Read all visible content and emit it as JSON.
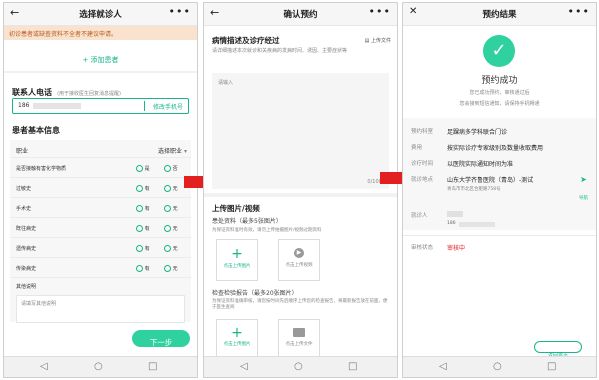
{
  "screen1": {
    "title": "选择就诊人",
    "back_icon": "back-arrow-icon",
    "more_icon": "more-icon",
    "warning": "初诊患者或缺查资料不全者不建议申请。",
    "add_patient": "+ 添加患者",
    "contact_heading": "联系人电话",
    "contact_note": "(用于接收医生回复消息提醒)",
    "phone_value": "186",
    "change_phone": "修改手机号",
    "basic_heading": "患者基本信息",
    "occupation_label": "职业",
    "occupation_select": "选择职业",
    "rows": [
      {
        "label": "是否接触有害化学物质",
        "opt_yes": "是",
        "opt_no": "否"
      },
      {
        "label": "过敏史",
        "opt_yes": "有",
        "opt_no": "无"
      },
      {
        "label": "手术史",
        "opt_yes": "有",
        "opt_no": "无"
      },
      {
        "label": "既往病史",
        "opt_yes": "有",
        "opt_no": "无"
      },
      {
        "label": "遗传病史",
        "opt_yes": "有",
        "opt_no": "无"
      },
      {
        "label": "传染病史",
        "opt_yes": "有",
        "opt_no": "无"
      }
    ],
    "other_label": "其他说明",
    "other_placeholder": "请填写其他说明",
    "next_button": "下一步"
  },
  "screen2": {
    "title": "确认预约",
    "back_icon": "back-arrow-icon",
    "more_icon": "more-icon",
    "desc_heading": "病情描述及诊疗经过",
    "upload_file": "上传文件",
    "desc_hint": "请详细描述本次就诊和关疾病的发病时间、诱因、主要症状等",
    "input_placeholder": "请输入",
    "char_count": "0/1000",
    "upload_heading": "上传图片/视频",
    "patient_info": "患处资料（最多5张图片）",
    "patient_info_hint": "为保证资料准时有效，请勿上传拍摄图片/视频过期资料",
    "upload_image": "点击上传图片",
    "upload_video": "点击上传视频",
    "exam_report": "检查检验报告（最多20张图片）",
    "exam_hint": "为保证资料准确审核，请您按时间先后顺序上传您的检查报告，将最新报告放在前面，便于医生查阅",
    "upload_image2": "点击上传图片",
    "upload_file2": "点击上传文件"
  },
  "screen3": {
    "title": "预约结果",
    "close_icon": "close-icon",
    "more_icon": "more-icon",
    "success_title": "预约成功",
    "success_msg1": "您已成功预约，审核通过后",
    "success_msg2": "您会接到短信通知，请保持手机畅通",
    "fields": [
      {
        "label": "预约科室",
        "value": "足踝病多学科联合门诊"
      },
      {
        "label": "费用",
        "value": "按实际诊疗专家级别及数量收取费用"
      },
      {
        "label": "诊疗时间",
        "value": "以医院实际通知时间为准"
      }
    ],
    "location_label": "就诊地点",
    "location_value": "山东大学齐鲁医院（青岛）-测试",
    "location_address": "青岛市市北区合肥路758号",
    "nav_label": "导航",
    "patient_label": "就诊人",
    "patient_phone": "186",
    "status_label": "审核状态",
    "status_value": "审核中",
    "home_button": "返回首页"
  },
  "colors": {
    "accent": "#18b58a",
    "warning_bg": "#f9e3cf",
    "status_red": "#e32020",
    "arrow": "#e32020"
  }
}
